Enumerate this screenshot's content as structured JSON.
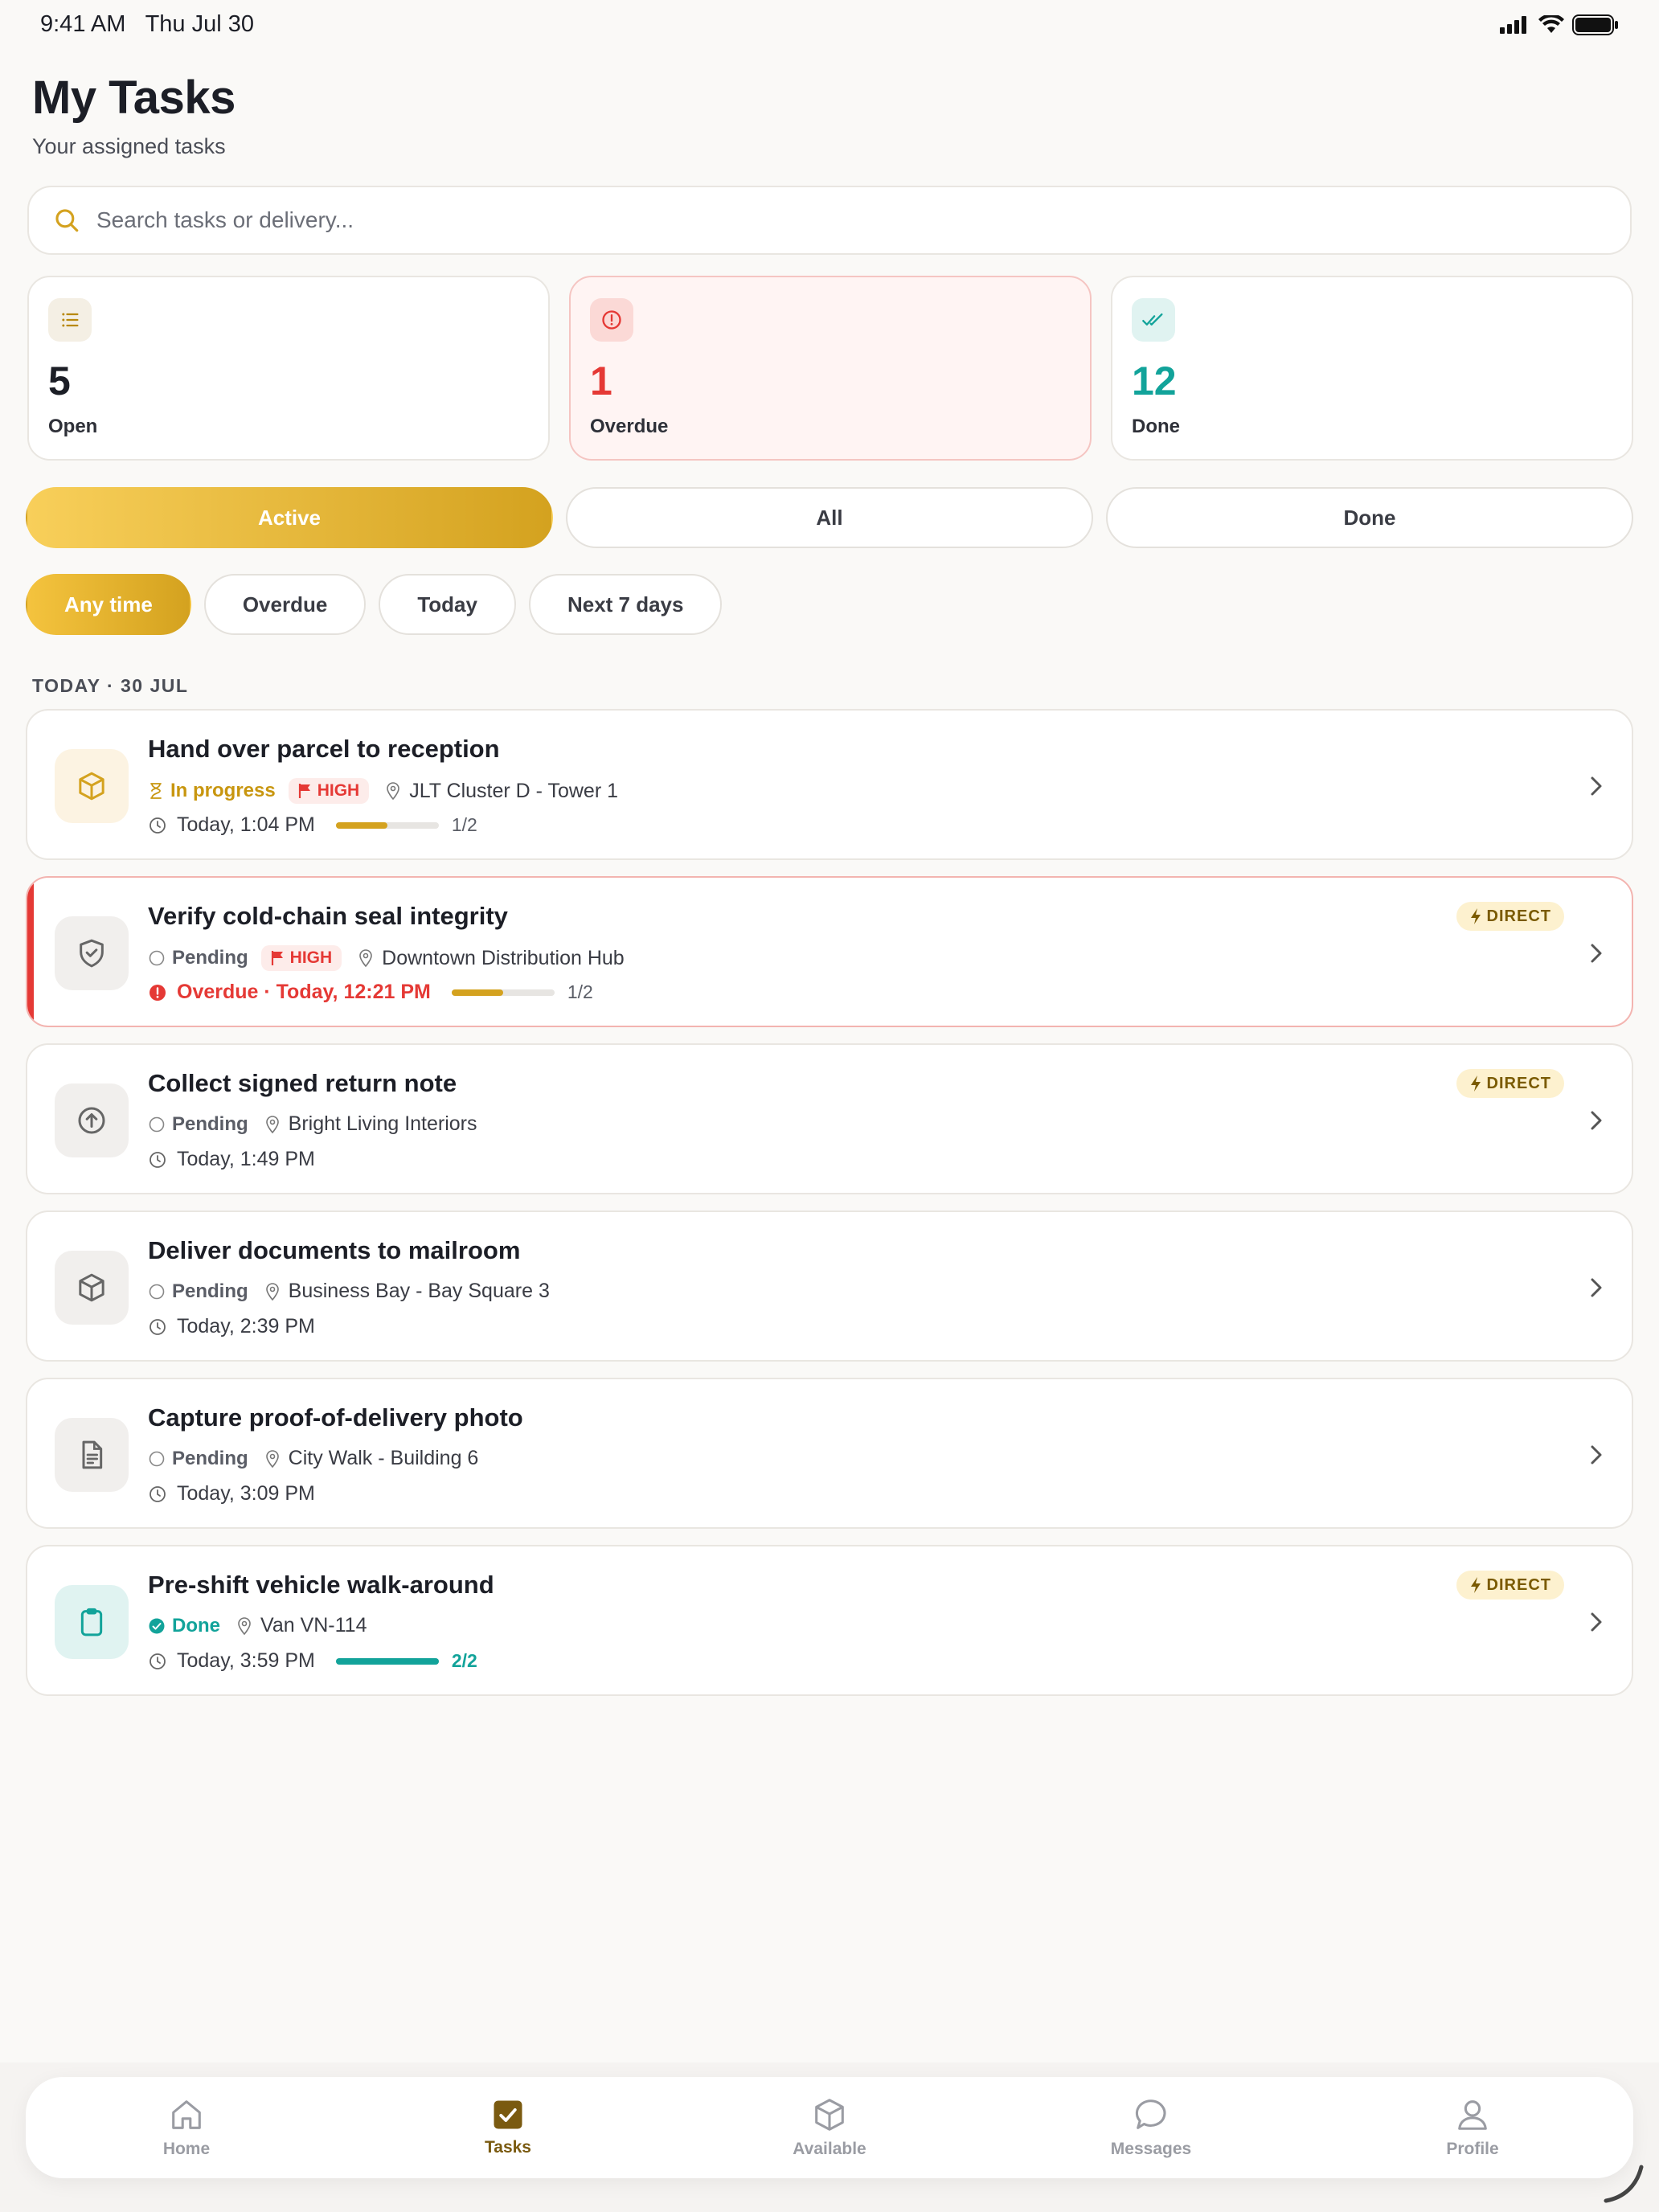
{
  "status_bar": {
    "time": "9:41 AM",
    "date": "Thu Jul 30"
  },
  "header": {
    "title": "My Tasks",
    "subtitle": "Your assigned tasks"
  },
  "search": {
    "placeholder": "Search tasks or delivery..."
  },
  "stats": [
    {
      "value": "5",
      "label": "Open",
      "icon": "list-icon",
      "color": "#1c1e26"
    },
    {
      "value": "1",
      "label": "Overdue",
      "icon": "alert-circle-icon",
      "color": "#e53935"
    },
    {
      "value": "12",
      "label": "Done",
      "icon": "double-check-icon",
      "color": "#12a39a"
    }
  ],
  "segments": [
    "Active",
    "All",
    "Done"
  ],
  "segments_active": "Active",
  "time_filters": [
    "Any time",
    "Overdue",
    "Today",
    "Next 7 days"
  ],
  "time_filters_active": "Any time",
  "section_label": "TODAY · 30 JUL",
  "tasks": [
    {
      "title": "Hand over parcel to reception",
      "status": "In progress",
      "priority": "HIGH",
      "location": "JLT Cluster D - Tower 1",
      "time": "Today, 1:04 PM",
      "progress": "1/2",
      "progress_fraction": 0.5,
      "icon": "box-icon",
      "direct": ""
    },
    {
      "title": "Verify cold-chain seal integrity",
      "status": "Pending",
      "priority": "HIGH",
      "location": "Downtown Distribution Hub",
      "time": "Overdue · Today, 12:21 PM",
      "progress": "1/2",
      "progress_fraction": 0.5,
      "icon": "shield-check-icon",
      "direct": "DIRECT"
    },
    {
      "title": "Collect signed return note",
      "status": "Pending",
      "priority": "",
      "location": "Bright Living Interiors",
      "time": "Today, 1:49 PM",
      "progress": "",
      "icon": "arrow-up-circle-icon",
      "direct": "DIRECT"
    },
    {
      "title": "Deliver documents to mailroom",
      "status": "Pending",
      "priority": "",
      "location": "Business Bay - Bay Square 3",
      "time": "Today, 2:39 PM",
      "progress": "",
      "icon": "box-icon",
      "direct": ""
    },
    {
      "title": "Capture proof-of-delivery photo",
      "status": "Pending",
      "priority": "",
      "location": "City Walk - Building 6",
      "time": "Today, 3:09 PM",
      "progress": "",
      "icon": "document-icon",
      "direct": ""
    },
    {
      "title": "Pre-shift vehicle walk-around",
      "status": "Done",
      "priority": "",
      "location": "Van VN-114",
      "time": "Today, 3:59 PM",
      "progress": "2/2",
      "progress_fraction": 1.0,
      "icon": "clipboard-icon",
      "direct": "DIRECT"
    }
  ],
  "tab_bar": [
    {
      "label": "Home",
      "icon": "home-icon"
    },
    {
      "label": "Tasks",
      "icon": "tasks-check-icon"
    },
    {
      "label": "Available",
      "icon": "box-icon"
    },
    {
      "label": "Messages",
      "icon": "chat-icon"
    },
    {
      "label": "Profile",
      "icon": "person-icon"
    }
  ],
  "tab_bar_active": "Tasks",
  "colors": {
    "accent": "#d4a21f",
    "danger": "#e53935",
    "success": "#12a39a"
  }
}
